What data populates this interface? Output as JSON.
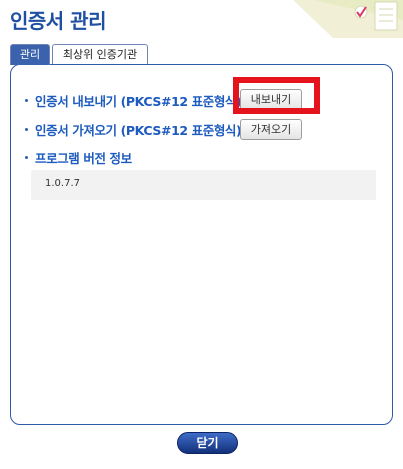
{
  "window": {
    "title": "인증서 관리"
  },
  "tabs": [
    {
      "label": "관리",
      "active": true
    },
    {
      "label": "최상위 인증기관",
      "active": false
    }
  ],
  "manage": {
    "export_label": "인증서 내보내기 (PKCS#12 표준형식)",
    "export_button": "내보내기",
    "import_label": "인증서 가져오기 (PKCS#12 표준형식)",
    "import_button": "가져오기",
    "version_label": "프로그램 버전 정보",
    "version_value": "1.0.7.7"
  },
  "footer": {
    "close_button": "닫기"
  },
  "colors": {
    "accent": "#1f4fa3",
    "label": "#1d5bbf",
    "highlight": "#e5141c",
    "close_button": "#1e3f95"
  }
}
